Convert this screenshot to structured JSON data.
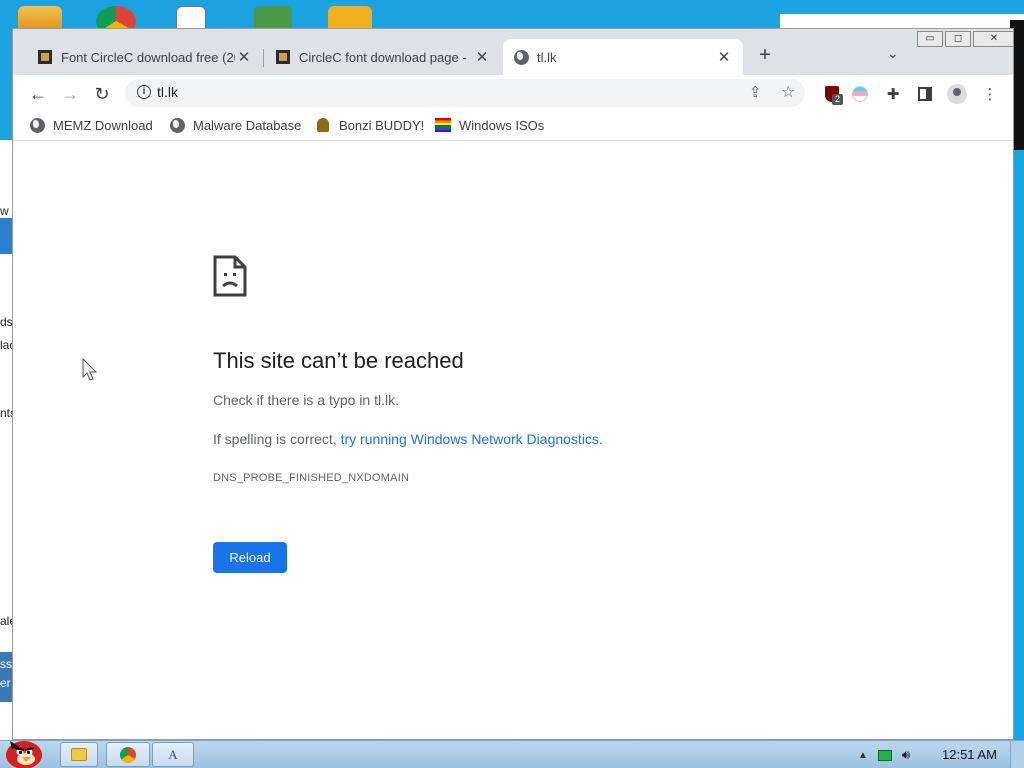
{
  "tabs": [
    {
      "title": "Font CircleC download free (20",
      "icon": "site-favicon"
    },
    {
      "title": "CircleC font download page -",
      "icon": "site-favicon"
    },
    {
      "title": "tl.lk",
      "icon": "globe-icon",
      "active": true
    }
  ],
  "new_tab_label": "+",
  "omnibox": {
    "url": "tl.lk"
  },
  "extensions": {
    "ublock_badge": "2"
  },
  "bookmarks": [
    {
      "label": "MEMZ Download",
      "icon": "globe-icon"
    },
    {
      "label": "Malware Database",
      "icon": "globe-icon"
    },
    {
      "label": "Bonzi BUDDY!",
      "icon": "bonzi-icon"
    },
    {
      "label": "Windows ISOs",
      "icon": "rainbow-flag-icon"
    }
  ],
  "error": {
    "title": "This site can’t be reached",
    "line1": "Check if there is a typo in tl.lk.",
    "line2_prefix": "If spelling is correct, ",
    "line2_link": "try running Windows Network Diagnostics",
    "line2_suffix": ".",
    "code": "DNS_PROBE_FINISHED_NXDOMAIN",
    "reload_label": "Reload"
  },
  "taskbar": {
    "clock": "12:51 AM"
  },
  "desktop_fragments": [
    "w",
    "ds",
    "lac",
    "nts",
    "ale",
    "ss",
    "er"
  ],
  "colors": {
    "accent": "#1a73e8",
    "text": "#202124",
    "secondary": "#5f6368",
    "tabstrip": "#dee1e6"
  }
}
